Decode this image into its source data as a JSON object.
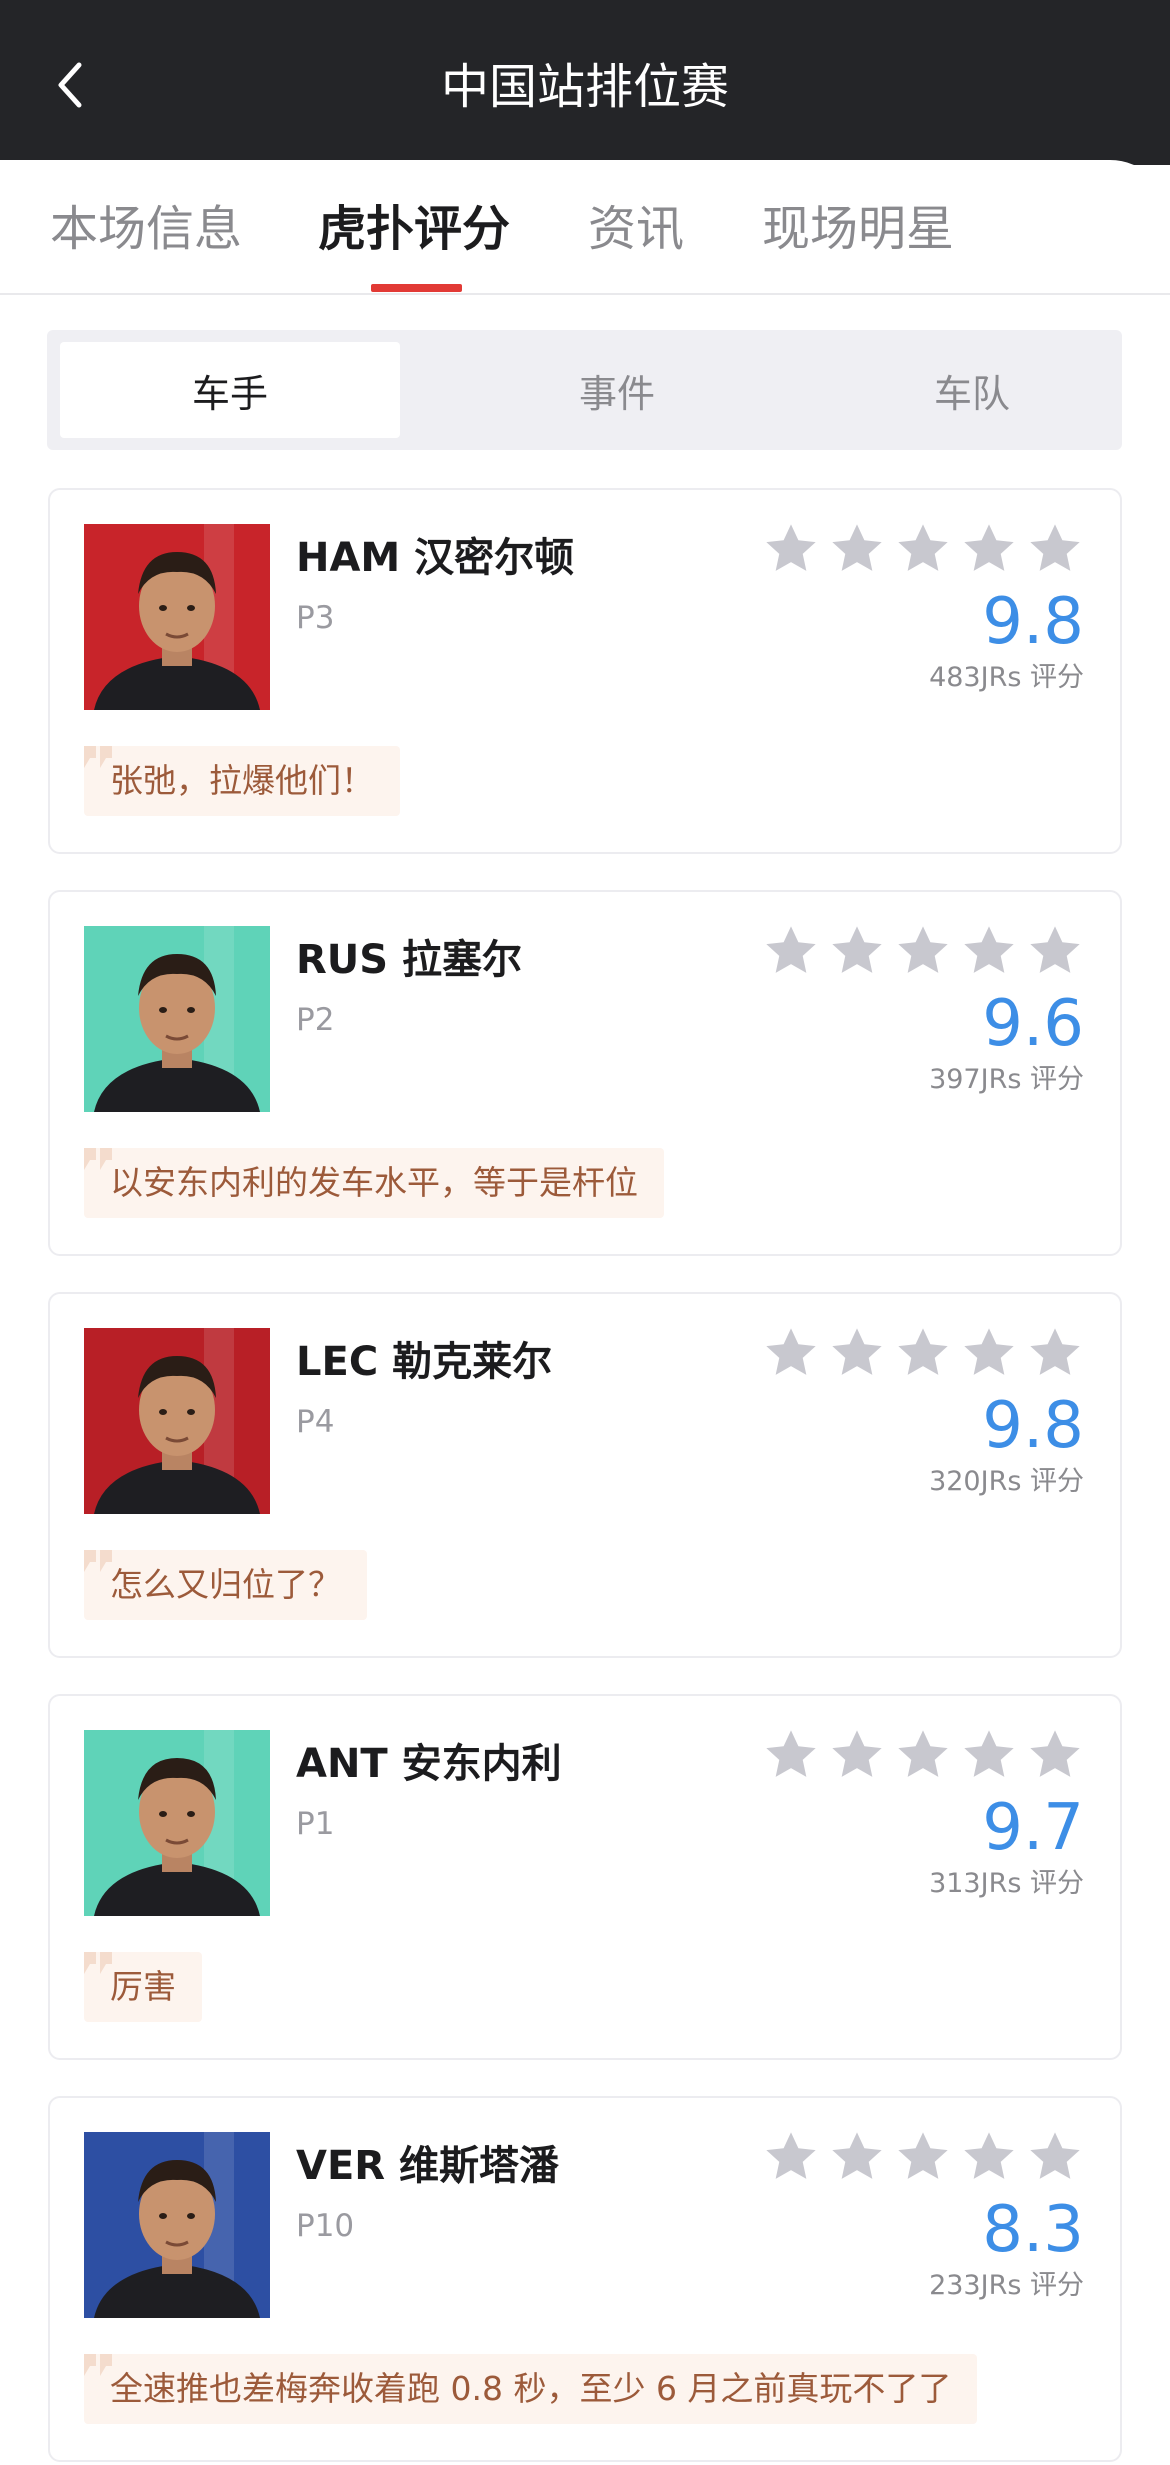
{
  "header": {
    "title": "中国站排位赛",
    "back_icon": "chevron-left-icon"
  },
  "tabs": [
    {
      "label": "本场信息",
      "active": false
    },
    {
      "label": "虎扑评分",
      "active": true
    },
    {
      "label": "资讯",
      "active": false
    },
    {
      "label": "现场明星",
      "active": false
    }
  ],
  "segments": [
    {
      "label": "车手",
      "active": true
    },
    {
      "label": "事件",
      "active": false
    },
    {
      "label": "车队",
      "active": false
    }
  ],
  "colors": {
    "accent": "#e23a35",
    "score": "#3d8ee6",
    "star_empty": "#c8c8cf",
    "comment_text": "#9c5a3a",
    "comment_bg": "#fdf4ee"
  },
  "drivers": [
    {
      "name": "HAM 汉密尔顿",
      "position": "P3",
      "score": "9.8",
      "count": "483JRs 评分",
      "comment": "张弛，拉爆他们！",
      "photo_color": "#c8242a",
      "photo_icon": "driver-portrait-icon"
    },
    {
      "name": "RUS 拉塞尔",
      "position": "P2",
      "score": "9.6",
      "count": "397JRs 评分",
      "comment": "以安东内利的发车水平，等于是杆位",
      "photo_color": "#5fd3b8",
      "photo_icon": "driver-portrait-icon"
    },
    {
      "name": "LEC 勒克莱尔",
      "position": "P4",
      "score": "9.8",
      "count": "320JRs 评分",
      "comment": "怎么又归位了？",
      "photo_color": "#b81f26",
      "photo_icon": "driver-portrait-icon"
    },
    {
      "name": "ANT 安东内利",
      "position": "P1",
      "score": "9.7",
      "count": "313JRs 评分",
      "comment": "厉害",
      "photo_color": "#5fd3b8",
      "photo_icon": "driver-portrait-icon"
    },
    {
      "name": "VER 维斯塔潘",
      "position": "P10",
      "score": "8.3",
      "count": "233JRs 评分",
      "comment": "全速推也差梅奔收着跑 0.8 秒，至少 6 月之前真玩不了了",
      "photo_color": "#2d4fa3",
      "photo_icon": "driver-portrait-icon"
    }
  ]
}
